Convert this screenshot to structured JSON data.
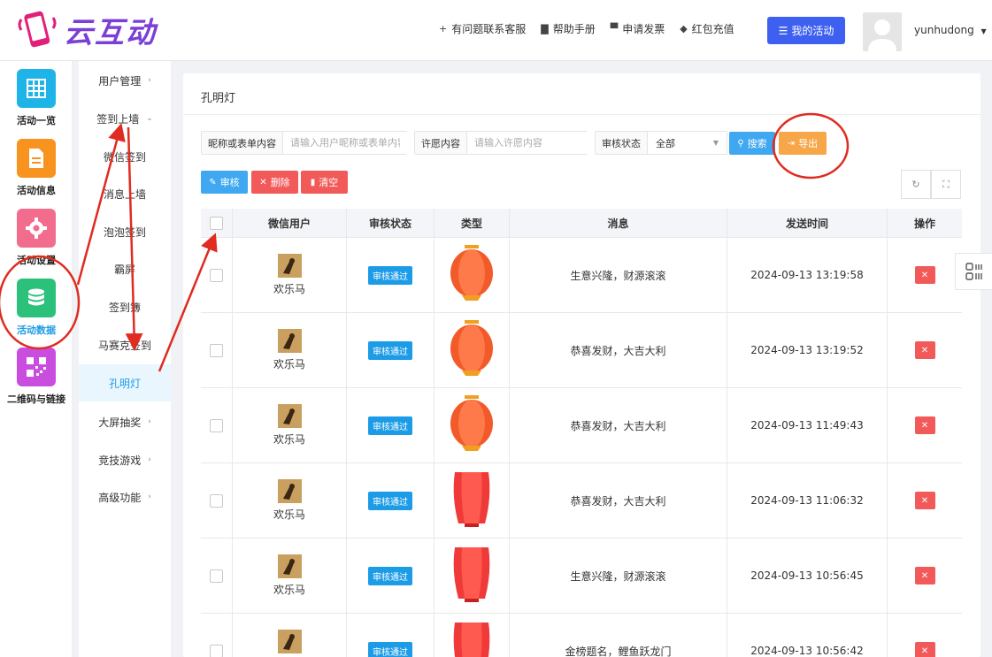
{
  "header": {
    "logo_text": "云互动",
    "links": [
      {
        "label": "有问题联系客服",
        "icon": "user-plus-icon"
      },
      {
        "label": "帮助手册",
        "icon": "book-icon"
      },
      {
        "label": "申请发票",
        "icon": "printer-icon"
      },
      {
        "label": "红包充值",
        "icon": "shield-check-icon"
      }
    ],
    "my_activity": "我的活动",
    "username": "yunhudong"
  },
  "iconbar": [
    {
      "label": "活动一览",
      "color": "#1fb4e8",
      "icon": "grid-icon"
    },
    {
      "label": "活动信息",
      "color": "#f7931e",
      "icon": "document-icon"
    },
    {
      "label": "活动设置",
      "color": "#f26c8e",
      "icon": "gear-icon"
    },
    {
      "label": "活动数据",
      "color": "#2bc17b",
      "icon": "database-icon"
    },
    {
      "label": "二维码与链接",
      "color": "#c94ee0",
      "icon": "qrcode-icon"
    }
  ],
  "menubar": [
    {
      "label": "用户管理",
      "chevron": "›"
    },
    {
      "label": "签到上墙",
      "chevron": "⌄"
    },
    {
      "label": "微信签到",
      "chevron": ""
    },
    {
      "label": "消息上墙",
      "chevron": ""
    },
    {
      "label": "泡泡签到",
      "chevron": ""
    },
    {
      "label": "霸屏",
      "chevron": ""
    },
    {
      "label": "签到簿",
      "chevron": ""
    },
    {
      "label": "马赛克签到",
      "chevron": ""
    },
    {
      "label": "孔明灯",
      "chevron": ""
    },
    {
      "label": "大屏抽奖",
      "chevron": "›"
    },
    {
      "label": "竞技游戏",
      "chevron": "›"
    },
    {
      "label": "高级功能",
      "chevron": "›"
    }
  ],
  "panel": {
    "title": "孔明灯",
    "filter_nick_label": "昵称或表单内容",
    "filter_nick_placeholder": "请输入用户昵称或表单内容",
    "filter_wish_label": "许愿内容",
    "filter_wish_placeholder": "请输入许愿内容",
    "filter_status_label": "审核状态",
    "filter_status_value": "全部",
    "search_label": "搜索",
    "export_label": "导出",
    "approve_label": "审核",
    "delete_label": "删除",
    "clear_label": "清空"
  },
  "table": {
    "headers": [
      "微信用户",
      "审核状态",
      "类型",
      "消息",
      "发送时间",
      "操作"
    ],
    "rows": [
      {
        "user": "欢乐马",
        "status": "审核通过",
        "lantern": "round",
        "message": "生意兴隆，财源滚滚",
        "time": "2024-09-13 13:19:58"
      },
      {
        "user": "欢乐马",
        "status": "审核通过",
        "lantern": "round",
        "message": "恭喜发财，大吉大利",
        "time": "2024-09-13 13:19:52"
      },
      {
        "user": "欢乐马",
        "status": "审核通过",
        "lantern": "round",
        "message": "恭喜发财，大吉大利",
        "time": "2024-09-13 11:49:43"
      },
      {
        "user": "欢乐马",
        "status": "审核通过",
        "lantern": "sky",
        "message": "恭喜发财，大吉大利",
        "time": "2024-09-13 11:06:32"
      },
      {
        "user": "欢乐马",
        "status": "审核通过",
        "lantern": "sky",
        "message": "生意兴隆，财源滚滚",
        "time": "2024-09-13 10:56:45"
      },
      {
        "user": "欢乐马",
        "status": "审核通过",
        "lantern": "sky",
        "message": "金榜题名，鲤鱼跃龙门",
        "time": "2024-09-13 10:56:42"
      }
    ]
  },
  "colors": {
    "primary": "#3e60f0",
    "accent_blue": "#1c9be6",
    "danger": "#f25a5a",
    "export": "#f7a74a",
    "annotation": "#e02b20"
  }
}
